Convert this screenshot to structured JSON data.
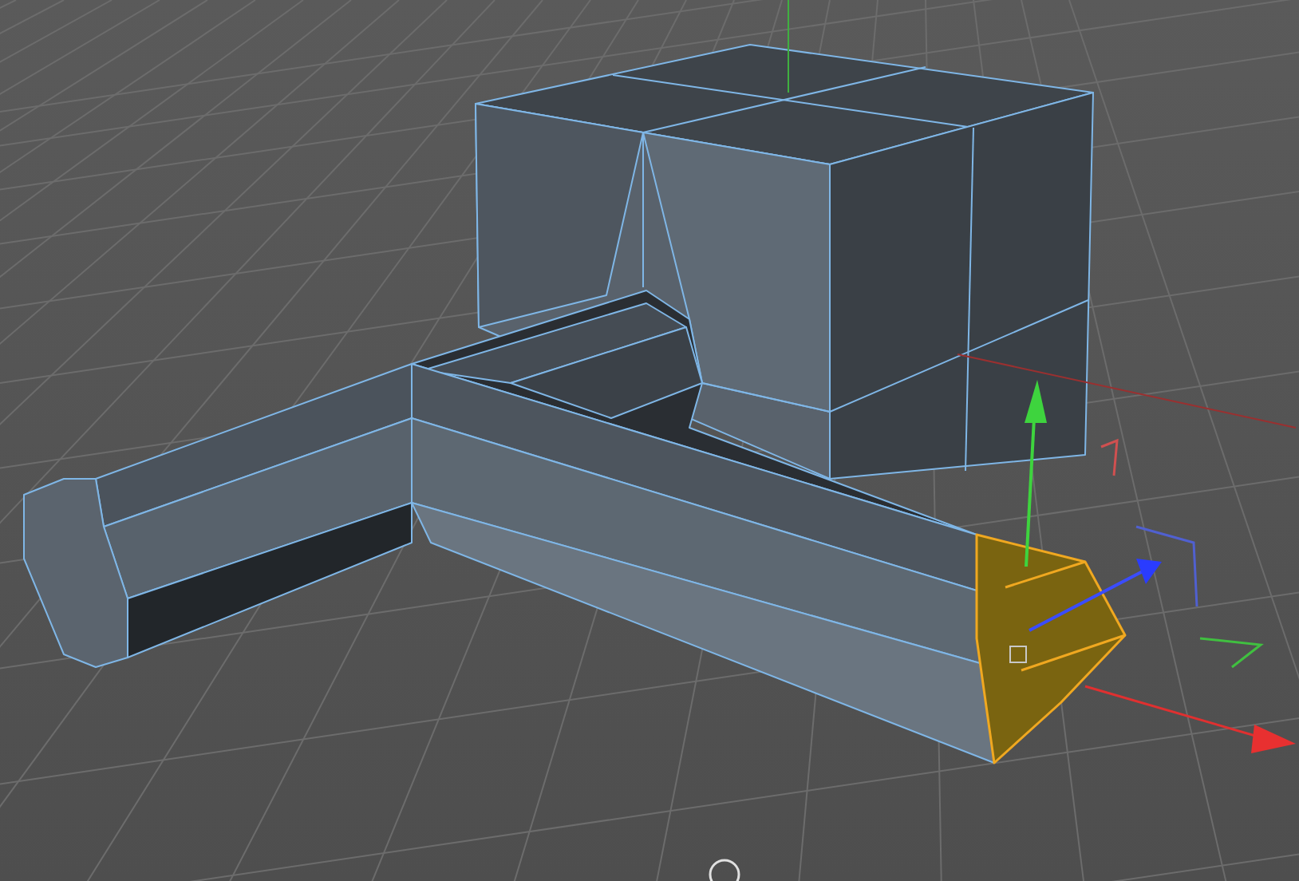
{
  "viewport": {
    "polygon_selected": true
  }
}
